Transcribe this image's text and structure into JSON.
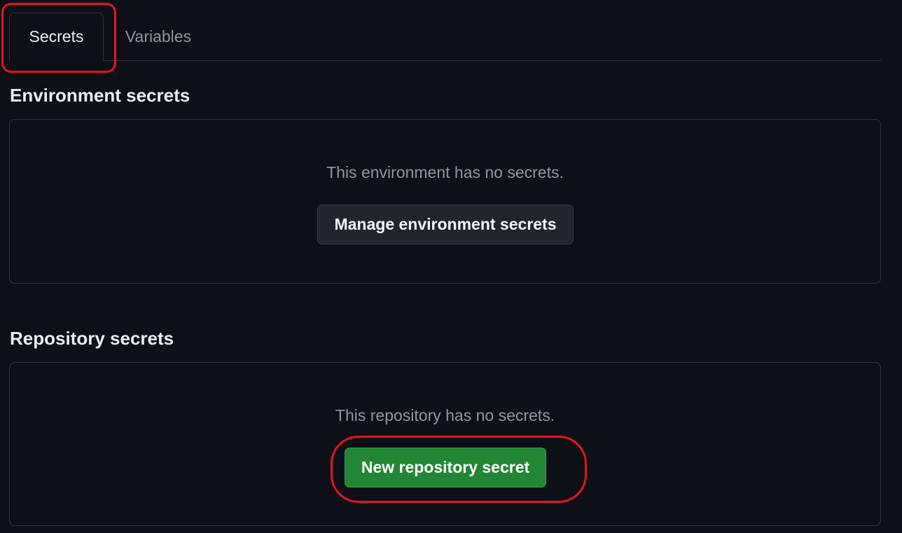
{
  "tabs": [
    {
      "label": "Secrets",
      "active": true
    },
    {
      "label": "Variables",
      "active": false
    }
  ],
  "environment_secrets": {
    "title": "Environment secrets",
    "empty_message": "This environment has no secrets.",
    "button_label": "Manage environment secrets"
  },
  "repository_secrets": {
    "title": "Repository secrets",
    "empty_message": "This repository has no secrets.",
    "button_label": "New repository secret"
  },
  "colors": {
    "background": "#0d1117",
    "border": "#30363d",
    "primary_button": "#238636",
    "annotation": "#e5141f"
  }
}
